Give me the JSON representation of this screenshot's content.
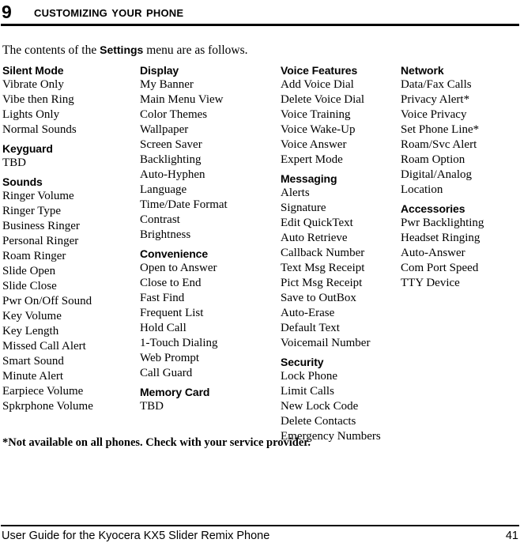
{
  "header": {
    "chapter_number": "9",
    "chapter_title": "Customizing Your Phone"
  },
  "intro": {
    "before": "The contents of the ",
    "bold": "Settings",
    "after": " menu are as follows."
  },
  "columns": [
    {
      "groups": [
        {
          "title": "Silent Mode",
          "items": [
            "Vibrate Only",
            "Vibe then Ring",
            "Lights Only",
            "Normal Sounds"
          ]
        },
        {
          "title": "Keyguard",
          "items": [
            "TBD"
          ]
        },
        {
          "title": "Sounds",
          "items": [
            "Ringer Volume",
            "Ringer Type",
            "Business Ringer",
            "Personal Ringer",
            "Roam Ringer",
            "Slide Open",
            "Slide Close",
            "Pwr On/Off Sound",
            "Key Volume",
            "Key Length",
            "Missed Call Alert",
            "Smart Sound",
            "Minute Alert",
            "Earpiece Volume",
            "Spkrphone Volume"
          ]
        }
      ]
    },
    {
      "groups": [
        {
          "title": "Display",
          "items": [
            "My Banner",
            "Main Menu View",
            "Color Themes",
            "Wallpaper",
            "Screen Saver",
            "Backlighting",
            "Auto-Hyphen",
            "Language",
            "Time/Date Format",
            "Contrast",
            "Brightness"
          ]
        },
        {
          "title": "Convenience",
          "items": [
            "Open to Answer",
            "Close to End",
            "Fast Find",
            "Frequent List",
            "Hold Call",
            "1-Touch Dialing",
            "Web Prompt",
            "Call Guard"
          ]
        },
        {
          "title": "Memory Card",
          "items": [
            "TBD"
          ]
        }
      ]
    },
    {
      "groups": [
        {
          "title": "Voice Features",
          "items": [
            "Add Voice Dial",
            "Delete Voice Dial",
            "Voice Training",
            "Voice Wake-Up",
            "Voice Answer",
            "Expert Mode"
          ]
        },
        {
          "title": "Messaging",
          "items": [
            "Alerts",
            "Signature",
            "Edit QuickText",
            "Auto Retrieve",
            "Callback Number",
            "Text Msg Receipt",
            "Pict Msg Receipt",
            "Save to OutBox",
            "Auto-Erase",
            "Default Text",
            "Voicemail Number"
          ]
        },
        {
          "title": "Security",
          "items": [
            "Lock Phone",
            "Limit Calls",
            "New Lock Code",
            "Delete Contacts",
            "Emergency Numbers"
          ]
        }
      ]
    },
    {
      "groups": [
        {
          "title": "Network",
          "items": [
            "Data/Fax Calls",
            "Privacy Alert*",
            "Voice Privacy",
            "Set Phone Line*",
            "Roam/Svc Alert",
            "Roam Option",
            "Digital/Analog",
            "Location"
          ]
        },
        {
          "title": "Accessories",
          "items": [
            "Pwr Backlighting",
            "Headset Ringing",
            "Auto-Answer",
            "Com Port Speed",
            "TTY Device"
          ]
        }
      ]
    }
  ],
  "footnote": "*Not available on all phones. Check with your service provider.",
  "footer": {
    "text": "User Guide for the Kyocera KX5 Slider Remix Phone",
    "page_number": "41"
  }
}
